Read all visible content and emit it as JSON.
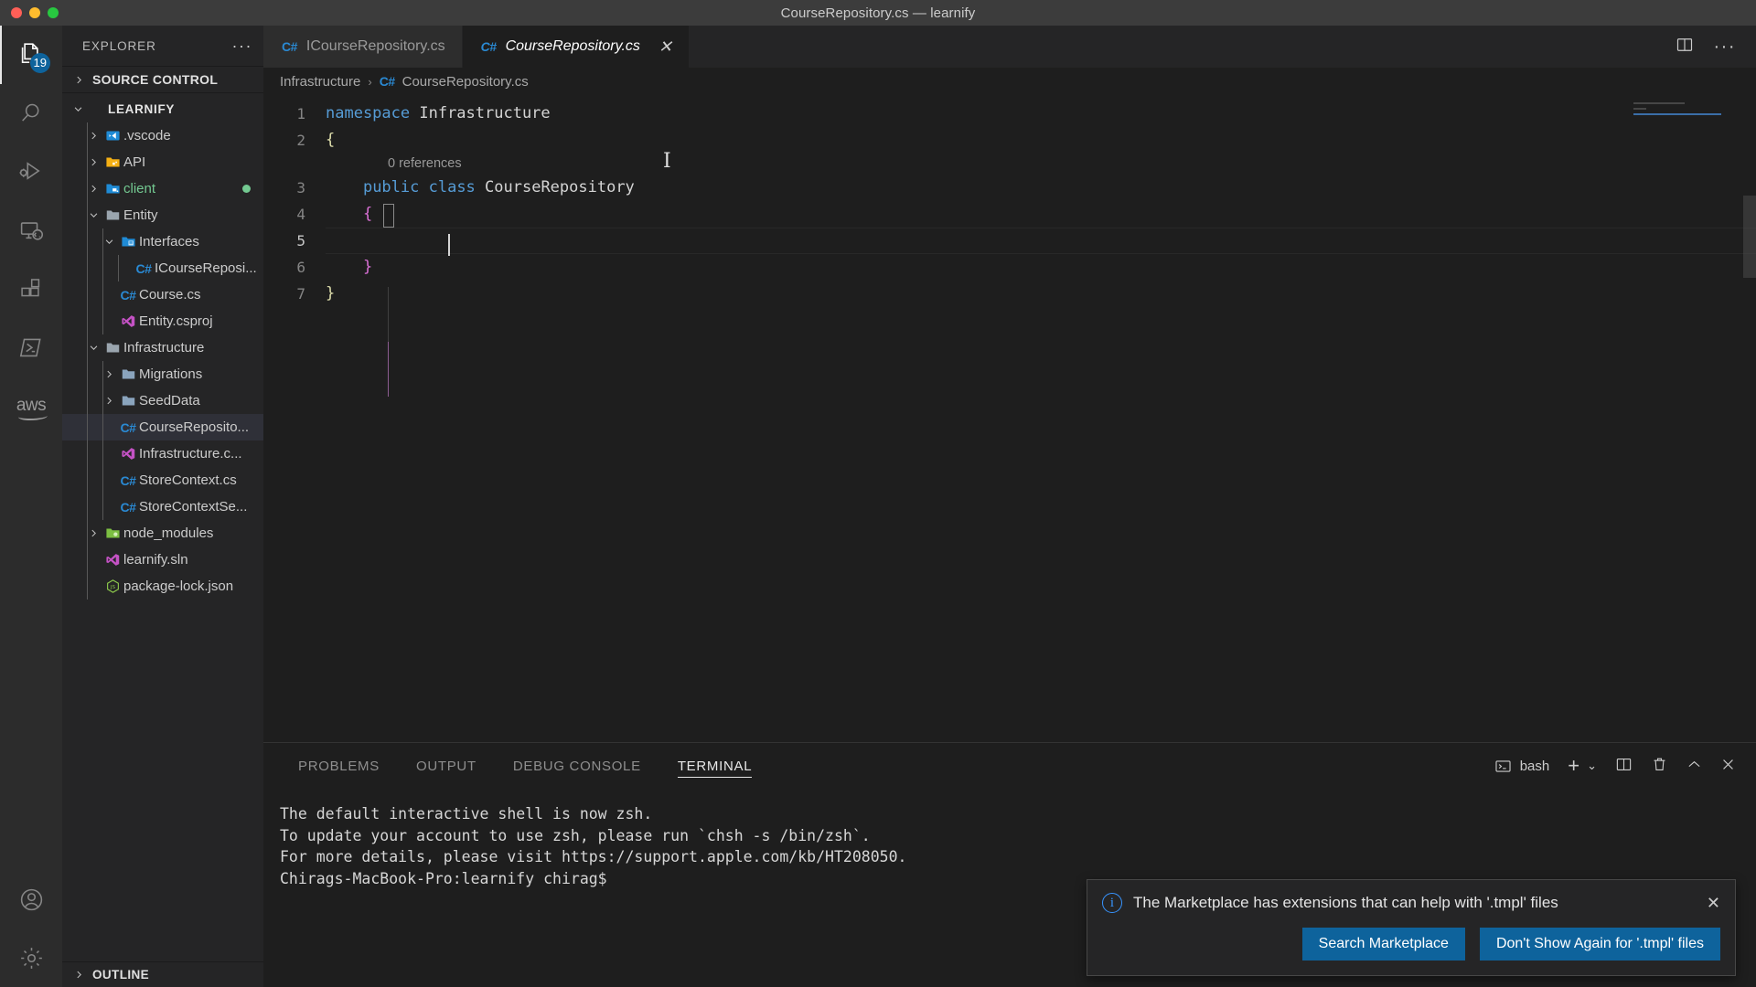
{
  "window": {
    "title": "CourseRepository.cs — learnify",
    "traffic_lights": [
      "close-red",
      "minimize-yellow",
      "maximize-green"
    ]
  },
  "activity_bar": {
    "items": [
      {
        "name": "explorer",
        "icon": "files-icon",
        "badge": "19",
        "active": true
      },
      {
        "name": "search",
        "icon": "search-icon",
        "badge": "",
        "active": false
      },
      {
        "name": "run-and-debug",
        "icon": "debug-icon",
        "badge": "",
        "active": false
      },
      {
        "name": "remote-explorer",
        "icon": "remote-icon",
        "badge": "",
        "active": false
      },
      {
        "name": "extensions",
        "icon": "extensions-icon",
        "badge": "",
        "active": false
      },
      {
        "name": "terminal-profile",
        "icon": "powershell-icon",
        "badge": "",
        "active": false
      },
      {
        "name": "aws-toolkit",
        "icon": "aws-icon",
        "badge": "",
        "active": false
      }
    ],
    "bottom_items": [
      {
        "name": "accounts",
        "icon": "account-icon"
      },
      {
        "name": "manage",
        "icon": "gear-icon"
      }
    ]
  },
  "sidebar": {
    "header_title": "EXPLORER",
    "more_actions": "···",
    "source_control_label": "SOURCE CONTROL",
    "outline_label": "OUTLINE",
    "tree": [
      {
        "label": "LEARNIFY",
        "depth": 0,
        "icon": "none",
        "chevron": "down",
        "selected": false,
        "root": true
      },
      {
        "label": ".vscode",
        "depth": 1,
        "icon": "vscode-folder",
        "chevron": "right",
        "selected": false,
        "root": false
      },
      {
        "label": "API",
        "depth": 1,
        "icon": "api-folder",
        "chevron": "right",
        "selected": false,
        "root": false
      },
      {
        "label": "client",
        "depth": 1,
        "icon": "client-folder",
        "chevron": "right",
        "selected": false,
        "root": false,
        "color": "#73c991",
        "dot": "#73c991"
      },
      {
        "label": "Entity",
        "depth": 1,
        "icon": "folder-open",
        "chevron": "down",
        "selected": false,
        "root": false
      },
      {
        "label": "Interfaces",
        "depth": 2,
        "icon": "interface-folder",
        "chevron": "down",
        "selected": false,
        "root": false
      },
      {
        "label": "ICourseReposi...",
        "depth": 3,
        "icon": "csharp",
        "chevron": "none",
        "selected": false,
        "root": false
      },
      {
        "label": "Course.cs",
        "depth": 2,
        "icon": "csharp",
        "chevron": "none",
        "selected": false,
        "root": false
      },
      {
        "label": "Entity.csproj",
        "depth": 2,
        "icon": "vs-proj",
        "chevron": "none",
        "selected": false,
        "root": false
      },
      {
        "label": "Infrastructure",
        "depth": 1,
        "icon": "folder-open",
        "chevron": "down",
        "selected": false,
        "root": false
      },
      {
        "label": "Migrations",
        "depth": 2,
        "icon": "folder",
        "chevron": "right",
        "selected": false,
        "root": false
      },
      {
        "label": "SeedData",
        "depth": 2,
        "icon": "folder",
        "chevron": "right",
        "selected": false,
        "root": false
      },
      {
        "label": "CourseReposito...",
        "depth": 2,
        "icon": "csharp",
        "chevron": "none",
        "selected": true,
        "root": false
      },
      {
        "label": "Infrastructure.c...",
        "depth": 2,
        "icon": "vs-proj",
        "chevron": "none",
        "selected": false,
        "root": false
      },
      {
        "label": "StoreContext.cs",
        "depth": 2,
        "icon": "csharp",
        "chevron": "none",
        "selected": false,
        "root": false
      },
      {
        "label": "StoreContextSe...",
        "depth": 2,
        "icon": "csharp",
        "chevron": "none",
        "selected": false,
        "root": false
      },
      {
        "label": "node_modules",
        "depth": 1,
        "icon": "node-folder",
        "chevron": "right",
        "selected": false,
        "root": false
      },
      {
        "label": "learnify.sln",
        "depth": 1,
        "icon": "vs-proj",
        "chevron": "none",
        "selected": false,
        "root": false
      },
      {
        "label": "package-lock.json",
        "depth": 1,
        "icon": "json-node",
        "chevron": "none",
        "selected": false,
        "root": false
      }
    ]
  },
  "editor": {
    "tabs": [
      {
        "label": "ICourseRepository.cs",
        "icon": "csharp-icon",
        "active": false,
        "closable": false
      },
      {
        "label": "CourseRepository.cs",
        "icon": "csharp-icon",
        "active": true,
        "closable": true,
        "close_glyph": "✕"
      }
    ],
    "actions": [
      {
        "name": "split-editor",
        "glyph": "split-icon"
      },
      {
        "name": "more-actions",
        "glyph": "···"
      }
    ],
    "breadcrumb": {
      "folder": "Infrastructure",
      "separator": "›",
      "file_icon": "csharp-icon",
      "file": "CourseRepository.cs"
    },
    "codelens": "0 references",
    "lines": [
      {
        "no": "1",
        "tokens": [
          {
            "t": "namespace ",
            "c": "kw"
          },
          {
            "t": "Infrastructure",
            "c": "plain"
          }
        ]
      },
      {
        "no": "2",
        "tokens": [
          {
            "t": "{",
            "c": "brace-y"
          }
        ]
      },
      {
        "no": "3",
        "tokens": [
          {
            "t": "    ",
            "c": "plain"
          },
          {
            "t": "public ",
            "c": "kw"
          },
          {
            "t": "class ",
            "c": "kw"
          },
          {
            "t": "CourseRepository",
            "c": "plain"
          }
        ]
      },
      {
        "no": "4",
        "tokens": [
          {
            "t": "    {",
            "c": "brace-p"
          }
        ]
      },
      {
        "no": "5",
        "tokens": [
          {
            "t": "        ",
            "c": "plain"
          }
        ]
      },
      {
        "no": "6",
        "tokens": [
          {
            "t": "    }",
            "c": "brace-p"
          }
        ]
      },
      {
        "no": "7",
        "tokens": [
          {
            "t": "}",
            "c": "brace-y"
          }
        ]
      }
    ],
    "active_line": "5"
  },
  "panel": {
    "tabs": [
      {
        "label": "PROBLEMS",
        "active": false
      },
      {
        "label": "OUTPUT",
        "active": false
      },
      {
        "label": "DEBUG CONSOLE",
        "active": false
      },
      {
        "label": "TERMINAL",
        "active": true
      }
    ],
    "shell_name": "bash",
    "shell_icon": "terminal-icon",
    "actions": [
      {
        "name": "new-terminal",
        "glyph": "+"
      },
      {
        "name": "terminal-dropdown",
        "glyph": "⌄"
      },
      {
        "name": "split-terminal",
        "glyph": "split-icon"
      },
      {
        "name": "kill-terminal",
        "glyph": "trash-icon"
      },
      {
        "name": "maximize-panel",
        "glyph": "⌃"
      },
      {
        "name": "close-panel",
        "glyph": "✕"
      }
    ],
    "terminal_output": [
      "The default interactive shell is now zsh.",
      "To update your account to use zsh, please run `chsh -s /bin/zsh`.",
      "For more details, please visit https://support.apple.com/kb/HT208050.",
      "Chirags-MacBook-Pro:learnify chirag$"
    ]
  },
  "notification": {
    "icon": "info-icon",
    "message": "The Marketplace has extensions that can help with '.tmpl' files",
    "close_glyph": "✕",
    "buttons": [
      {
        "label": "Search Marketplace"
      },
      {
        "label": "Don't Show Again for '.tmpl' files"
      }
    ]
  },
  "colors": {
    "accent": "#0e639c",
    "keyword": "#569cd6",
    "brace_yellow": "#dcdcaa",
    "brace_purple": "#da70d6",
    "badge": "#0e639c",
    "info": "#3794ff",
    "git_modified": "#73c991"
  }
}
